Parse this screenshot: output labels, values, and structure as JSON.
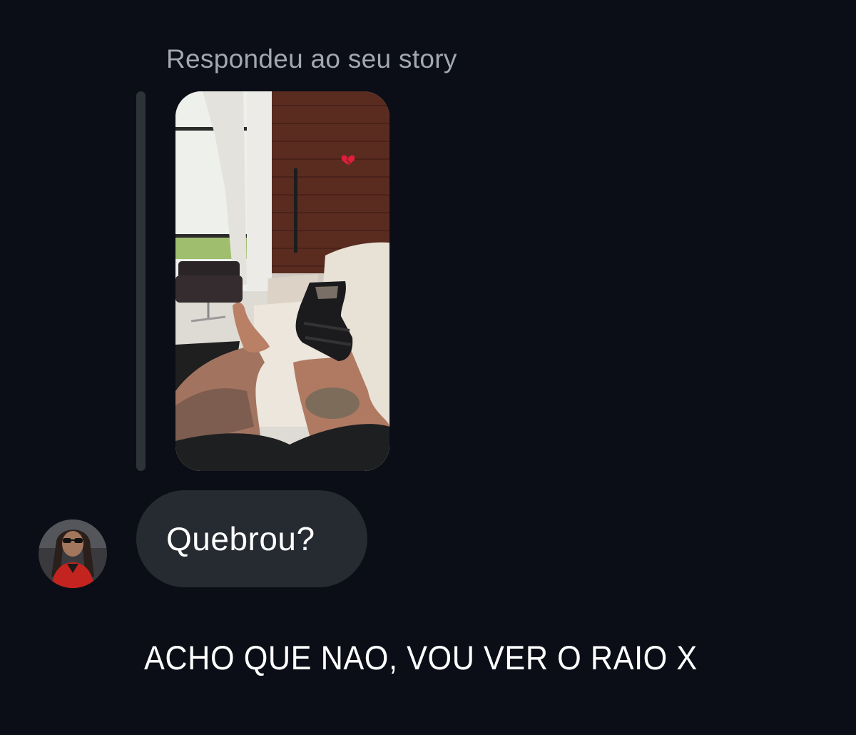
{
  "story_reply": {
    "header": "Respondeu ao seu story",
    "story_sticker": "broken-heart-emoji"
  },
  "message": {
    "text": "Quebrou?",
    "avatar": "user-avatar"
  },
  "caption": {
    "text": "ACHO QUE NAO, VOU VER O RAIO X"
  },
  "colors": {
    "background": "#0b0e16",
    "bubble": "#262a31",
    "quote_bar": "#2e3239",
    "header_text": "#a3a7b0",
    "message_text": "#ffffff"
  }
}
